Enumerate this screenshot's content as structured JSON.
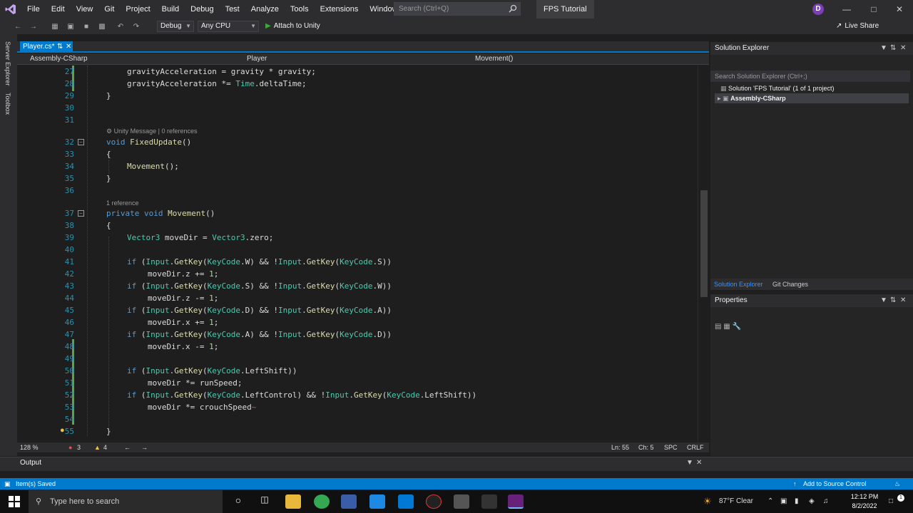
{
  "menubar": {
    "items": [
      "File",
      "Edit",
      "View",
      "Git",
      "Project",
      "Build",
      "Debug",
      "Test",
      "Analyze",
      "Tools",
      "Extensions",
      "Window",
      "Help"
    ],
    "search_placeholder": "Search (Ctrl+Q)",
    "solution_name": "FPS Tutorial",
    "user_initial": "D"
  },
  "toolbar": {
    "config": "Debug",
    "platform": "Any CPU",
    "attach_label": "Attach to Unity",
    "live_share": "Live Share"
  },
  "left_strip": {
    "tabs": [
      "Server Explorer",
      "Toolbox"
    ]
  },
  "editor": {
    "tab_label": "Player.cs*",
    "nav_project": "Assembly-CSharp",
    "nav_class": "Player",
    "nav_member": "Movement()",
    "zoom": "128 %",
    "errors": "3",
    "warnings": "4",
    "ln": "Ln: 55",
    "ch": "Ch: 5",
    "spc": "SPC",
    "crlf": "CRLF",
    "hint_fixedupdate": "Unity Message | 0 references",
    "hint_movement": "1 reference",
    "line_numbers": [
      "27",
      "28",
      "29",
      "30",
      "31",
      "32",
      "33",
      "34",
      "35",
      "36",
      "37",
      "38",
      "39",
      "40",
      "41",
      "42",
      "43",
      "44",
      "45",
      "46",
      "47",
      "48",
      "49",
      "50",
      "51",
      "52",
      "53",
      "54",
      "55"
    ]
  },
  "solution_explorer": {
    "title": "Solution Explorer",
    "search_placeholder": "Search Solution Explorer (Ctrl+;)",
    "solution_item": "Solution 'FPS Tutorial' (1 of 1 project)",
    "project_item": "Assembly-CSharp",
    "tabs": [
      "Solution Explorer",
      "Git Changes"
    ]
  },
  "properties": {
    "title": "Properties"
  },
  "output": {
    "title": "Output"
  },
  "statusbar": {
    "left": "Item(s) Saved",
    "right": "Add to Source Control"
  },
  "taskbar": {
    "search_placeholder": "Type here to search",
    "weather": "87°F  Clear",
    "time": "12:12 PM",
    "date": "8/2/2022",
    "notifications": "1"
  },
  "colors": {
    "accent": "#007acc",
    "editor_bg": "#1e1e1e",
    "keyword": "#569cd6",
    "type": "#4ec9b0",
    "method": "#dcdcaa"
  }
}
